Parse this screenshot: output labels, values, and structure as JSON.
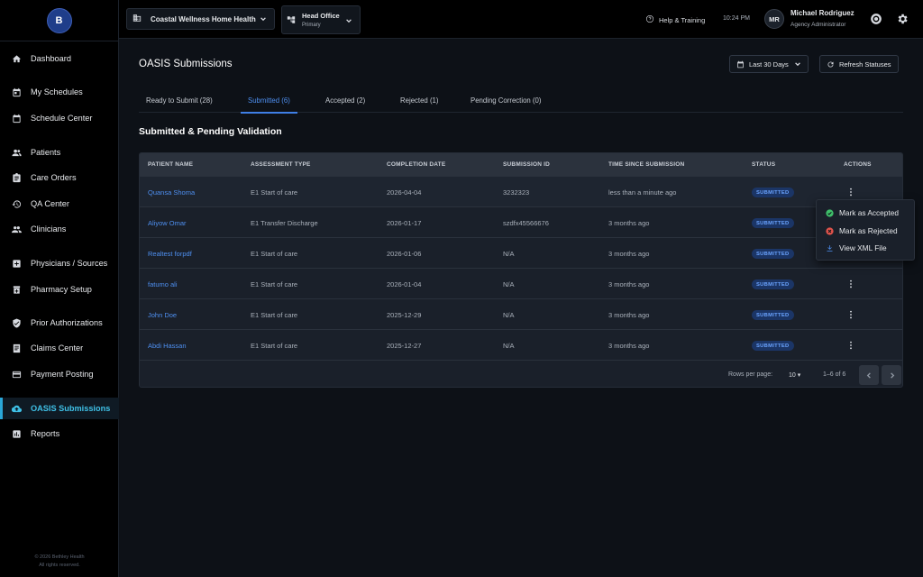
{
  "brand": {
    "logo_text": "B"
  },
  "sidebar": {
    "items": [
      {
        "label": "Dashboard",
        "icon": "home-icon"
      },
      {
        "label": "My Schedules",
        "icon": "calendar-check-icon"
      },
      {
        "label": "Schedule Center",
        "icon": "calendar-icon"
      },
      {
        "label": "Patients",
        "icon": "users-icon"
      },
      {
        "label": "Care Orders",
        "icon": "clipboard-icon"
      },
      {
        "label": "QA Center",
        "icon": "history-icon"
      },
      {
        "label": "Clinicians",
        "icon": "group-icon"
      },
      {
        "label": "Physicians / Sources",
        "icon": "plus-square-icon"
      },
      {
        "label": "Pharmacy Setup",
        "icon": "medication-icon"
      },
      {
        "label": "Prior Authorizations",
        "icon": "shield-check-icon"
      },
      {
        "label": "Claims Center",
        "icon": "receipt-icon"
      },
      {
        "label": "Payment Posting",
        "icon": "card-icon"
      },
      {
        "label": "OASIS Submissions",
        "icon": "cloud-upload-icon",
        "active": true
      },
      {
        "label": "Reports",
        "icon": "chart-icon"
      }
    ],
    "footer_line1": "© 2026 Bethley Health",
    "footer_line2": "All rights reserved."
  },
  "topbar": {
    "agency": "Coastal Wellness Home Health",
    "office_name": "Head Office",
    "office_sub": "Primary",
    "help": "Help & Training",
    "time": "10:24 PM",
    "initials": "MR",
    "user_name": "Michael Rodriguez",
    "user_role": "Agency Administrator"
  },
  "page": {
    "title": "OASIS Submissions",
    "date_filter": "Last 30 Days",
    "refresh": "Refresh Statuses",
    "section_title": "Submitted & Pending Validation"
  },
  "tabs": [
    {
      "label": "Ready to Submit (28)"
    },
    {
      "label": "Submitted (6)",
      "active": true
    },
    {
      "label": "Accepted (2)"
    },
    {
      "label": "Rejected (1)"
    },
    {
      "label": "Pending Correction (0)"
    }
  ],
  "table": {
    "headers": [
      "PATIENT NAME",
      "ASSESSMENT TYPE",
      "COMPLETION DATE",
      "SUBMISSION ID",
      "TIME SINCE SUBMISSION",
      "STATUS",
      "ACTIONS"
    ],
    "rows": [
      {
        "patient": "Quansa Shoma",
        "type": "E1 Start of care",
        "date": "2026-04-04",
        "sub_id": "3232323",
        "since": "less than a minute ago",
        "status": "SUBMITTED"
      },
      {
        "patient": "Aliyow Omar",
        "type": "E1 Transfer Discharge",
        "date": "2026-01-17",
        "sub_id": "szdfx45566676",
        "since": "3 months ago",
        "status": "SUBMITTED"
      },
      {
        "patient": "Realtest forpdf",
        "type": "E1 Start of care",
        "date": "2026-01-06",
        "sub_id": "N/A",
        "since": "3 months ago",
        "status": "SUBMITTED"
      },
      {
        "patient": "fatumo ali",
        "type": "E1 Start of care",
        "date": "2026-01-04",
        "sub_id": "N/A",
        "since": "3 months ago",
        "status": "SUBMITTED"
      },
      {
        "patient": "John Doe",
        "type": "E1 Start of care",
        "date": "2025-12-29",
        "sub_id": "N/A",
        "since": "3 months ago",
        "status": "SUBMITTED"
      },
      {
        "patient": "Abdi Hassan",
        "type": "E1 Start of care",
        "date": "2025-12-27",
        "sub_id": "N/A",
        "since": "3 months ago",
        "status": "SUBMITTED"
      }
    ],
    "footer": {
      "rows_per_page_label": "Rows per page:",
      "rows_per_page_value": "10",
      "range": "1–6 of 6"
    }
  },
  "menu": {
    "accept": "Mark as Accepted",
    "reject": "Mark as Rejected",
    "xml": "View XML File"
  },
  "colors": {
    "accent": "#4e8ff0",
    "active_nav": "#3fc0e6",
    "badge_bg": "#1b3566",
    "success": "#3fbf6a",
    "danger": "#e0534b"
  }
}
